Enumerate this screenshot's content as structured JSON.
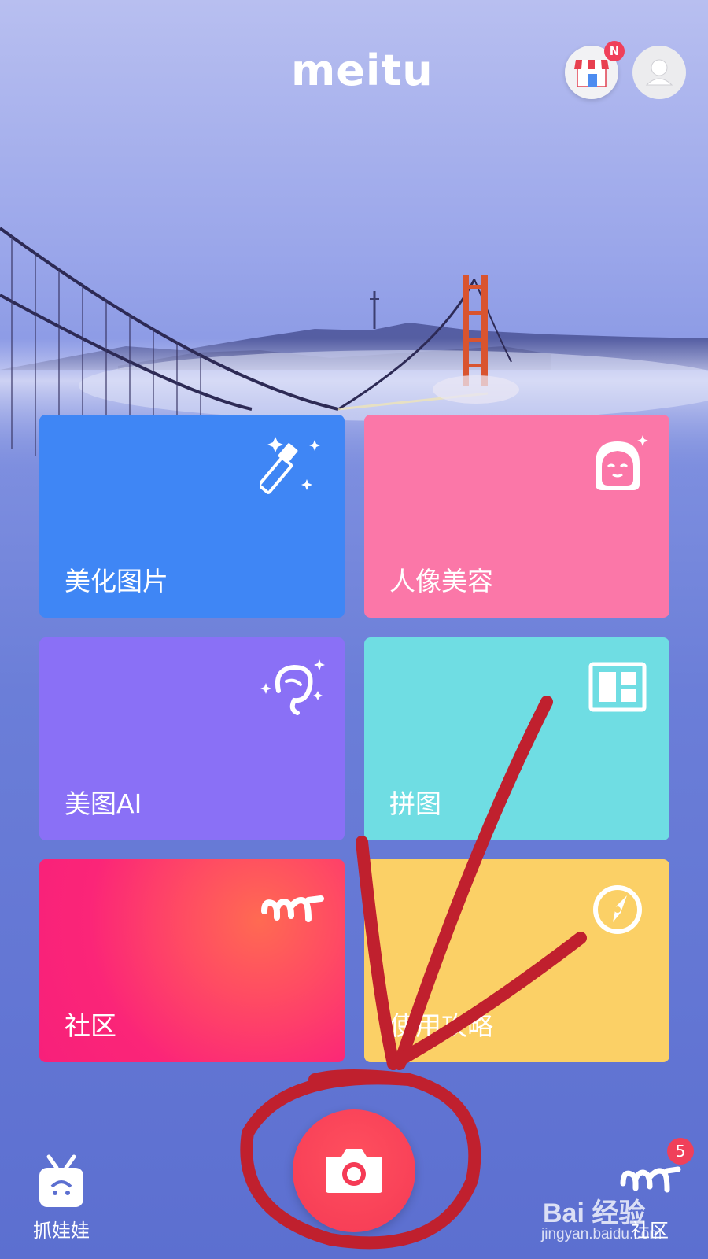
{
  "header": {
    "logo_text": "meitu",
    "store_badge": "N"
  },
  "tiles": [
    {
      "label": "美化图片",
      "icon": "magic-wand-icon",
      "color": "#3f86f5"
    },
    {
      "label": "人像美容",
      "icon": "face-icon",
      "color": "#fb77a8"
    },
    {
      "label": "美图AI",
      "icon": "ai-hair-icon",
      "color": "#8a70f6"
    },
    {
      "label": "拼图",
      "icon": "collage-icon",
      "color": "#6fdde3"
    },
    {
      "label": "社区",
      "icon": "meitu-community-icon",
      "color": "#f7207a"
    },
    {
      "label": "使用攻略",
      "icon": "compass-icon",
      "color": "#fbd066"
    }
  ],
  "bottom_bar": {
    "left_label": "抓娃娃",
    "right_label": "社区",
    "right_badge": "5"
  },
  "watermark": {
    "logo": "Bai 经验",
    "url": "jingyan.baidu.com"
  },
  "colors": {
    "accent_red": "#f53a55",
    "annotation_red": "#c0202e"
  }
}
